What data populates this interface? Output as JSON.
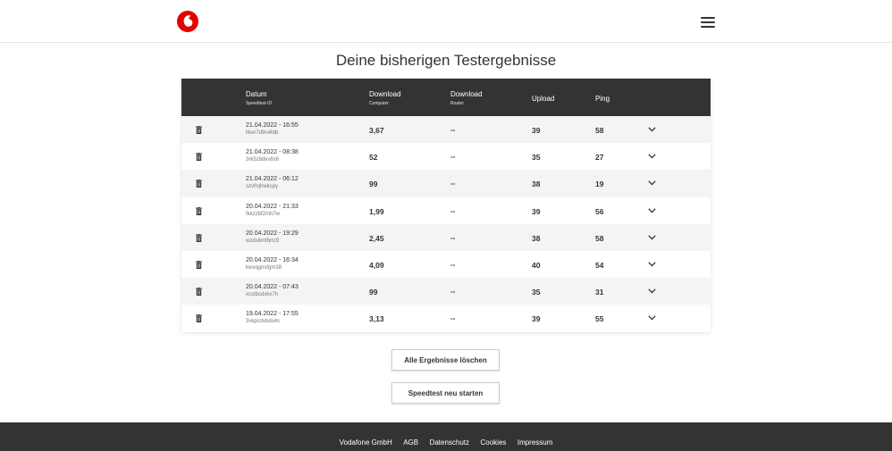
{
  "header": {
    "logo_icon": "vodafone-logo-icon",
    "menu_icon": "hamburger-menu-icon",
    "brand_color": "#e60000"
  },
  "page_title": "Deine bisherigen Testergebnisse",
  "table": {
    "columns": {
      "datum": "Datum",
      "datum_sub": "Speedtest-ID",
      "download_computer": "Download",
      "download_computer_sub": "Computer",
      "download_router": "Download",
      "download_router_sub": "Router",
      "upload": "Upload",
      "ping": "Ping"
    },
    "rows": [
      {
        "date": "21.04.2022 - 16:55",
        "id": "f4xn7d9n4fdb",
        "download": "3,67",
        "router": "--",
        "upload": "39",
        "ping": "58"
      },
      {
        "date": "21.04.2022 - 08:38",
        "id": "3rk5z8dkv8s6",
        "download": "52",
        "router": "--",
        "upload": "35",
        "ping": "27"
      },
      {
        "date": "21.04.2022 - 06:12",
        "id": "szvfrqhwkspy",
        "download": "99",
        "router": "--",
        "upload": "38",
        "ping": "19"
      },
      {
        "date": "20.04.2022 - 21:33",
        "id": "fkkzzbf2mh7w",
        "download": "1,99",
        "router": "--",
        "upload": "39",
        "ping": "56"
      },
      {
        "date": "20.04.2022 - 19:29",
        "id": "wzds6mfbrtc9",
        "download": "2,45",
        "router": "--",
        "upload": "38",
        "ping": "58"
      },
      {
        "date": "20.04.2022 - 16:34",
        "id": "kwxqgnsfgm38",
        "download": "4,09",
        "router": "--",
        "upload": "40",
        "ping": "54"
      },
      {
        "date": "20.04.2022 - 07:43",
        "id": "xcstbcdxkx7h",
        "download": "99",
        "router": "--",
        "upload": "35",
        "ping": "31"
      },
      {
        "date": "19.04.2022 - 17:55",
        "id": "3vkpcdvbds4s",
        "download": "3,13",
        "router": "--",
        "upload": "39",
        "ping": "55"
      }
    ],
    "row_icons": {
      "delete": "trash-icon",
      "expand": "chevron-down-icon"
    }
  },
  "buttons": {
    "delete_all": "Alle Ergebnisse löschen",
    "restart": "Speedtest neu starten"
  },
  "footer": {
    "links": [
      "Vodafone GmbH",
      "AGB",
      "Datenschutz",
      "Cookies",
      "Impressum"
    ]
  }
}
